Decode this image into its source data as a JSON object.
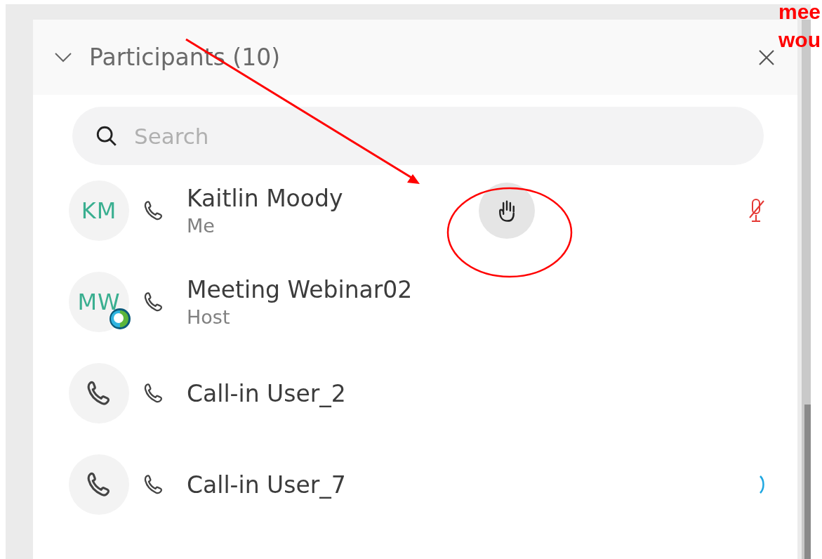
{
  "panel": {
    "title": "Participants (10)",
    "expanded": true
  },
  "search": {
    "placeholder": "Search"
  },
  "participants": [
    {
      "avatar": {
        "kind": "initials",
        "initials": "KM",
        "host_badge": false
      },
      "name": "Kaitlin Moody",
      "role": "Me",
      "hand_raised": true,
      "muted": true,
      "speaking": false
    },
    {
      "avatar": {
        "kind": "initials",
        "initials": "MW",
        "host_badge": true
      },
      "name": "Meeting Webinar02",
      "role": "Host",
      "hand_raised": false,
      "muted": false,
      "speaking": false
    },
    {
      "avatar": {
        "kind": "phone",
        "host_badge": false
      },
      "name": "Call-in User_2",
      "hand_raised": false,
      "muted": false,
      "speaking": false
    },
    {
      "avatar": {
        "kind": "phone",
        "host_badge": false
      },
      "name": "Call-in User_7",
      "hand_raised": false,
      "muted": false,
      "speaking": true
    }
  ],
  "annotations": [
    "mee",
    "wou"
  ]
}
